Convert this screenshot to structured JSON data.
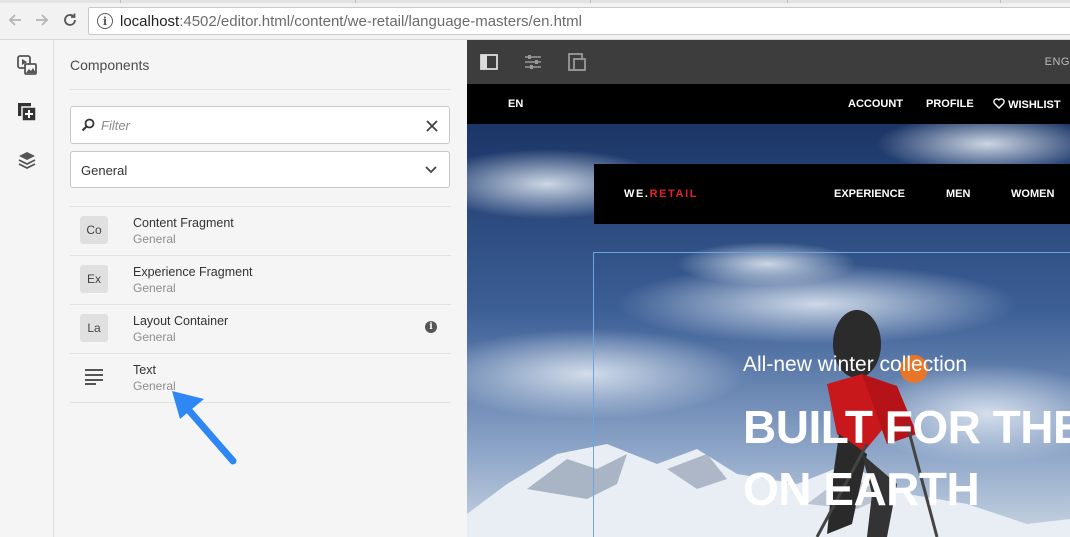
{
  "browser": {
    "url_host": "localhost",
    "url_path": ":4502/editor.html/content/we-retail/language-masters/en.html"
  },
  "panel": {
    "title": "Components",
    "filter_placeholder": "Filter",
    "group_selected": "General",
    "components": [
      {
        "badge": "Co",
        "name": "Content Fragment",
        "category": "General"
      },
      {
        "badge": "Ex",
        "name": "Experience Fragment",
        "category": "General"
      },
      {
        "badge": "La",
        "name": "Layout Container",
        "category": "General"
      },
      {
        "badge": "",
        "name": "Text",
        "category": "General",
        "icon": "text-align-icon"
      }
    ]
  },
  "editor": {
    "language_label": "ENG",
    "site_top": {
      "lang": "EN",
      "account": "ACCOUNT",
      "profile": "PROFILE",
      "wishlist": "WISHLIST"
    },
    "site_nav": {
      "brand_prefix": "WE.",
      "brand_suffix": "RETAIL",
      "links": [
        "EXPERIENCE",
        "MEN",
        "WOMEN"
      ]
    },
    "hero": {
      "subtitle": "All-new winter collection",
      "title_line1": "BUILT FOR THE",
      "title_line2": "ON EARTH"
    }
  },
  "colors": {
    "brand_red": "#e2222b",
    "arrow_blue": "#2f86f5",
    "selection_outline": "#6aa7e0"
  }
}
